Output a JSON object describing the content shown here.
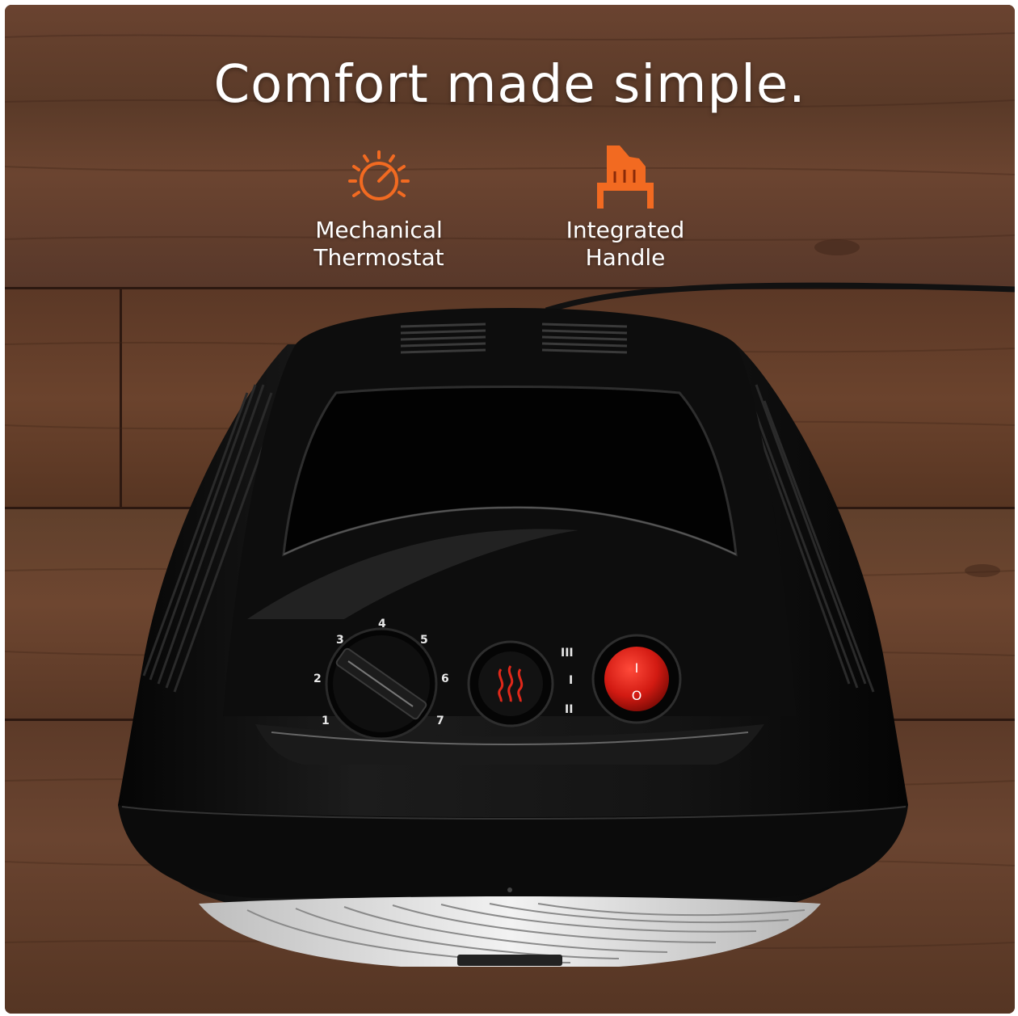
{
  "headline": "Comfort made simple.",
  "features": [
    {
      "icon": "sun-dial-icon",
      "line1": "Mechanical",
      "line2": "Thermostat"
    },
    {
      "icon": "hand-grip-icon",
      "line1": "Integrated",
      "line2": "Handle"
    }
  ],
  "thermostat_dial": {
    "numbers": [
      "1",
      "2",
      "3",
      "4",
      "5",
      "6",
      "7"
    ]
  },
  "mode_markings": [
    "III",
    "I",
    "II"
  ],
  "power_switch": {
    "on_symbol": "I",
    "off_symbol": "O"
  },
  "colors": {
    "icon_orange": "#f26a21",
    "switch_red": "#d21a12",
    "wood": "#5e3a26",
    "heater_body": "#0c0c0c"
  }
}
